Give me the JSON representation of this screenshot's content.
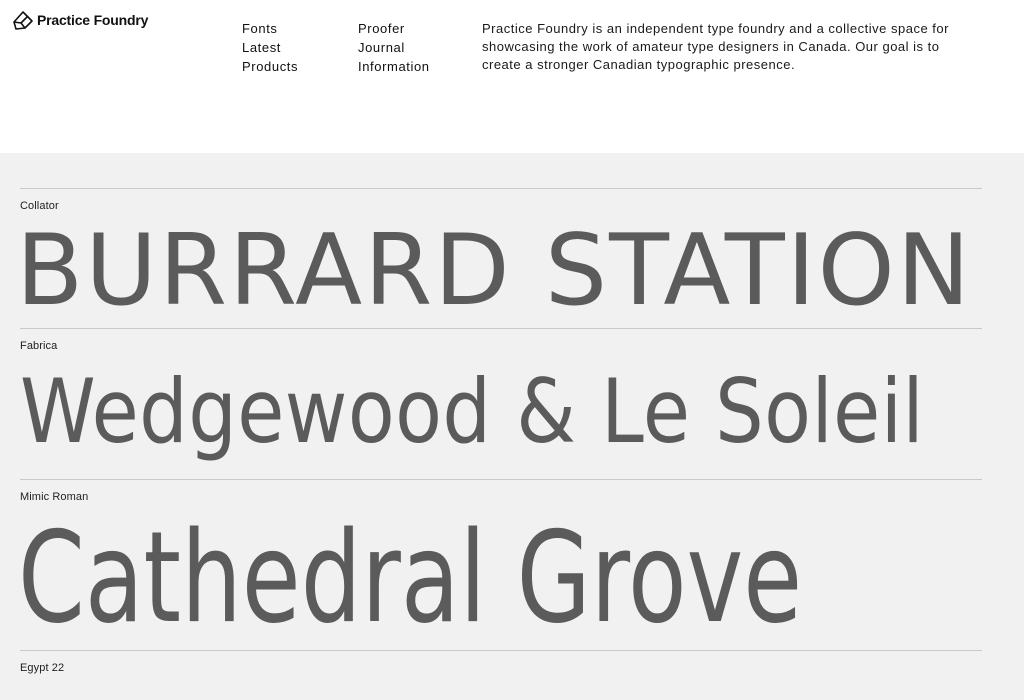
{
  "brand": {
    "name": "Practice Foundry",
    "icon": "pencil-cube-icon",
    "accent_color": "#e8ff00"
  },
  "nav": {
    "column1": [
      {
        "label": "Fonts"
      },
      {
        "label": "Latest"
      },
      {
        "label": "Products"
      }
    ],
    "column2": [
      {
        "label": "Proofer"
      },
      {
        "label": "Journal"
      },
      {
        "label": "Information"
      }
    ]
  },
  "about": "Practice Foundry is an independent type foundry and a collective space for showcasing the work of amateur type designers in Canada. Our goal is to create a stronger Canadian typographic presence.",
  "specimens": [
    {
      "font": "Collator",
      "sample": "BURRARD STATION"
    },
    {
      "font": "Fabrica",
      "sample": "Wedgewood & Le Soleil"
    },
    {
      "font": "Mimic Roman",
      "sample": "Cathedral  Grove"
    },
    {
      "font": "Egypt 22",
      "sample": ""
    }
  ],
  "colors": {
    "specimen_text": "#5b5b5b",
    "panel_background": "#f1f1f1",
    "divider": "#c9c9c9"
  }
}
